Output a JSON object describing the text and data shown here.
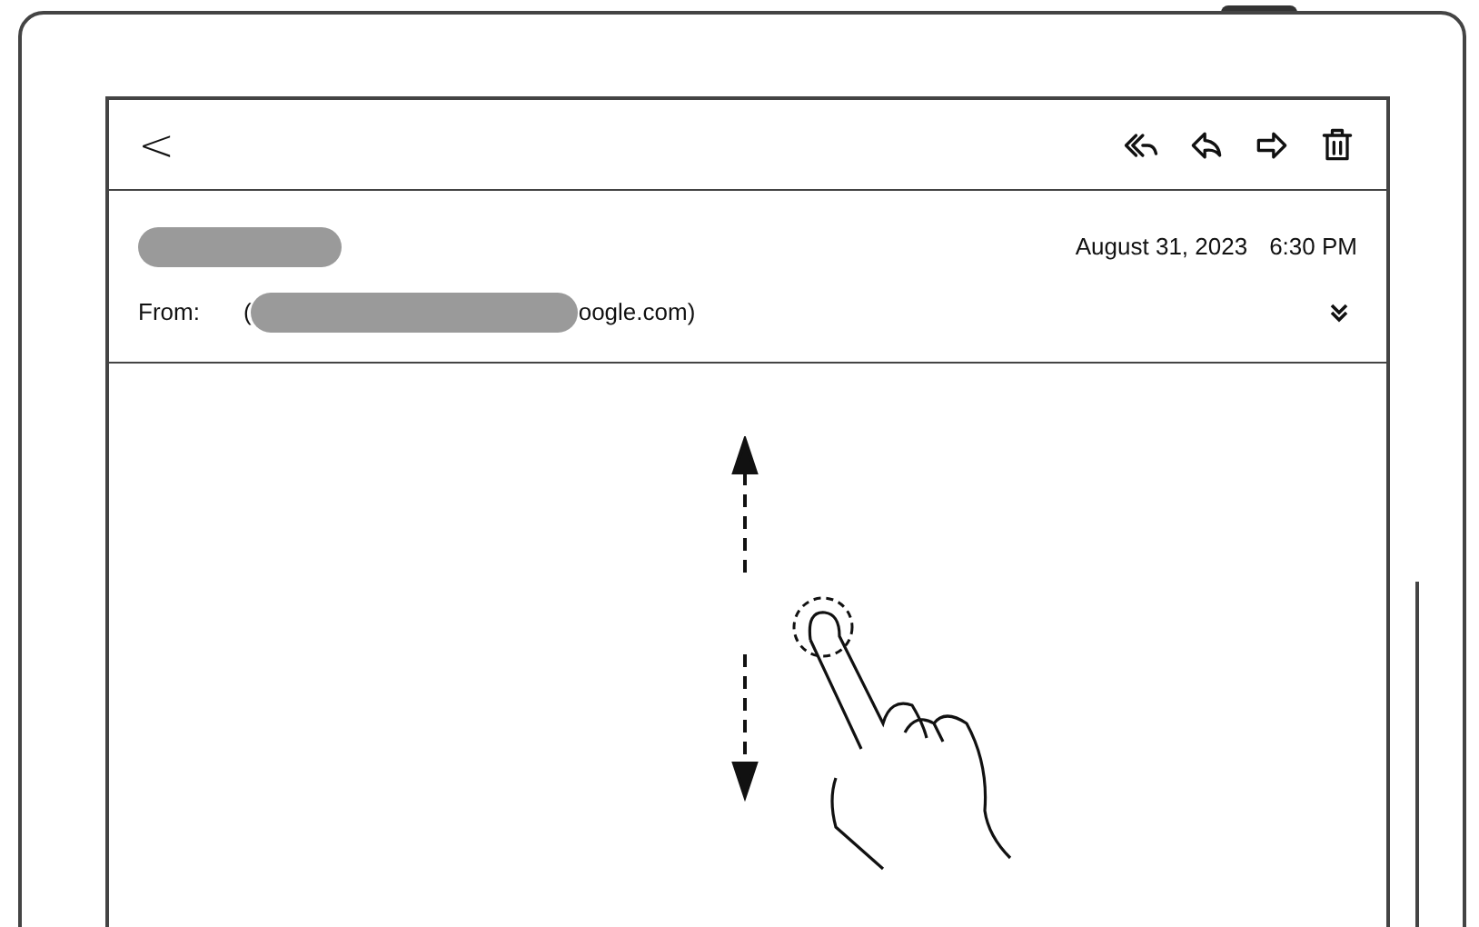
{
  "toolbar": {
    "back": "<"
  },
  "email": {
    "date": "August 31, 2023",
    "time": "6:30 PM",
    "from_label": "From:",
    "sender_prefix": "(",
    "sender_suffix": "oogle.com)",
    "sender_name_redacted": true,
    "sender_address_redacted": true
  }
}
